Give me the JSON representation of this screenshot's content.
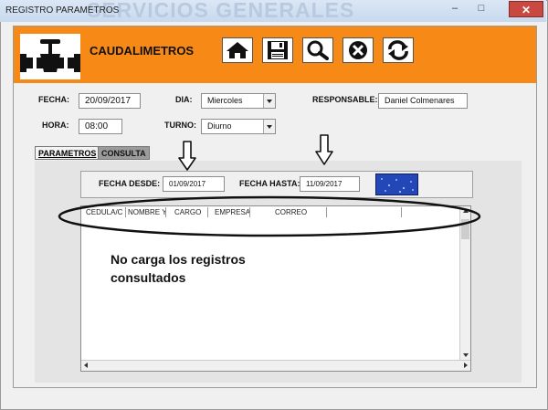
{
  "window": {
    "title": "REGISTRO PARAMETROS",
    "ghost_text": "SERVICIOS GENERALES",
    "controls": {
      "minimize": "–",
      "maximize": "□",
      "close": "✕"
    }
  },
  "header": {
    "title": "CAUDALIMETROS",
    "background": "#f78a17",
    "logo_icon": "pipe-valve-icon",
    "toolbar": [
      "home-icon",
      "save-icon",
      "search-icon",
      "cancel-icon",
      "refresh-icon"
    ]
  },
  "form": {
    "fecha": {
      "label": "FECHA:",
      "value": "20/09/2017"
    },
    "dia": {
      "label": "DIA:",
      "value": "Miercoles"
    },
    "responsable": {
      "label": "RESPONSABLE:",
      "value": "Daniel Colmenares"
    },
    "hora": {
      "label": "HORA:",
      "value": "08:00"
    },
    "turno": {
      "label": "TURNO:",
      "value": "Diurno"
    }
  },
  "tabs": [
    {
      "label": "PARAMETROS",
      "active": false
    },
    {
      "label": "CONSULTA",
      "active": true
    }
  ],
  "consulta": {
    "desde": {
      "label": "FECHA DESDE:",
      "value": "01/09/2017"
    },
    "hasta": {
      "label": "FECHA HASTA:",
      "value": "11/09/2017"
    },
    "columns": [
      "CEDULA/C",
      "NOMBRE Y",
      "CARGO",
      "EMPRESA",
      "CORREO",
      "",
      ""
    ]
  },
  "annotation": {
    "note": "No carga los registros\nconsultados"
  }
}
